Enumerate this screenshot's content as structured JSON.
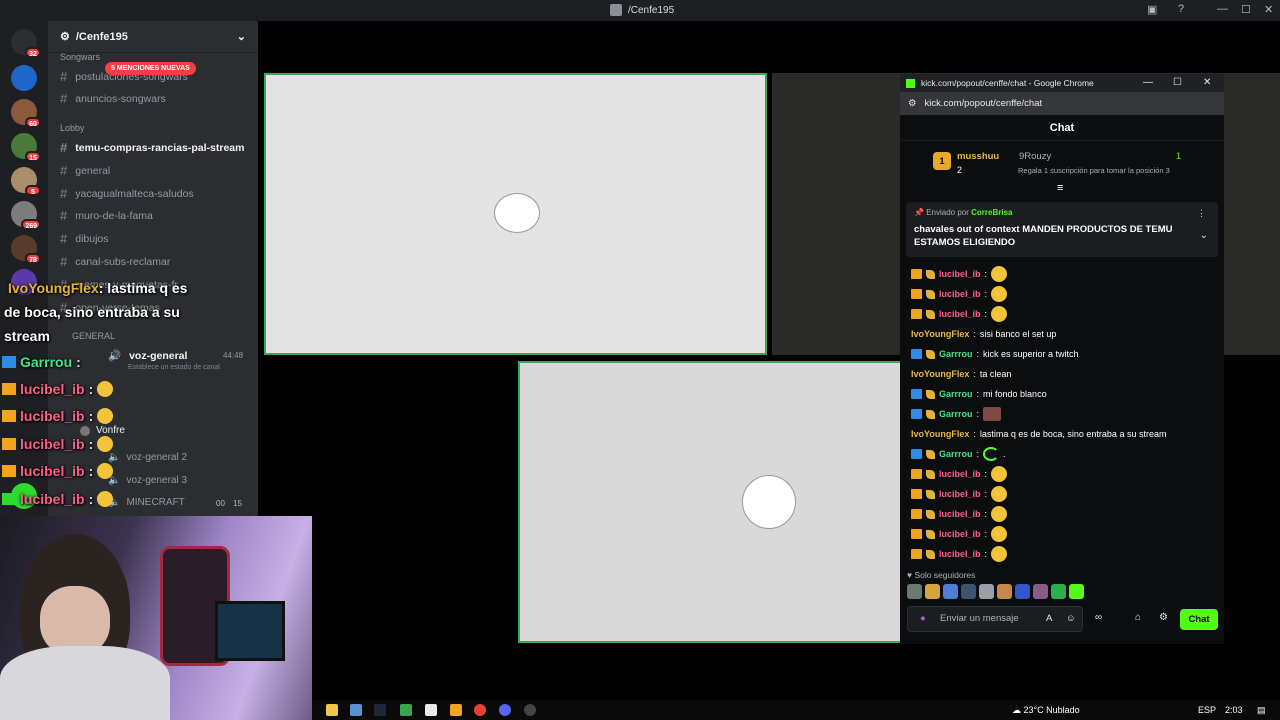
{
  "window": {
    "title": "/Cenfe195",
    "minimize": "—",
    "maximize": "☐",
    "close": "✕"
  },
  "discord": {
    "server_name": "/Cenfe195",
    "server_badges": [
      "32",
      "60",
      "15",
      "5",
      "269",
      "78"
    ],
    "mention_pill": "5 MENCIONES NUEVAS",
    "categories": {
      "songwars": "Songwars",
      "lobby": "Lobby",
      "general": "GENERAL"
    },
    "channels": [
      "postulaciones-songwars",
      "anuncios-songwars",
      "temu-compras-rancias-pal-stream",
      "general",
      "yacagualmalteca-saludos",
      "muro-de-la-fama",
      "dibujos",
      "canal-subs-reclamar",
      "memes-y-maquetas-fr",
      "open-verse-temas"
    ],
    "voice_channel": "voz-general",
    "voice_time": "44:48",
    "voice_status": "Establece un estado de canal",
    "voice_user": "Vonfre",
    "voice_channels": [
      "voz-general 2",
      "voz-general 3",
      "MINECRAFT"
    ],
    "minecraft_counts": [
      "00",
      "15"
    ]
  },
  "overlay": {
    "msg_user": "IvoYoungFlex",
    "msg_text_1": ": lastima q es",
    "msg_text_2": "de boca, sino entraba a su",
    "msg_text_3": "stream",
    "chat_lines": [
      {
        "user": "Garrrou",
        "sep": ":"
      },
      {
        "user": "lucibel_ib",
        "sep": ":"
      },
      {
        "user": "lucibel_ib",
        "sep": ":"
      },
      {
        "user": "lucibel_ib",
        "sep": ":"
      },
      {
        "user": "lucibel_ib",
        "sep": ":"
      },
      {
        "user": "lucibel_ib",
        "sep": ":"
      }
    ]
  },
  "kick": {
    "window_title": "kick.com/popout/cenffe/chat - Google Chrome",
    "url": "kick.com/popout/cenffe/chat",
    "chat_header": "Chat",
    "top_user": "musshuu",
    "top_user_count": "2",
    "top_right_count": "1",
    "gift_user": "9Rouzy",
    "gift_text": "Regala 1 suscripción para tomar la posición 3",
    "pinned_by_label": "Enviado por",
    "pinned_by_user": "CorreBrisa",
    "pinned_text": "chavales out of context MANDEN PRODUCTOS DE TEMU ESTAMOS ELIGIENDO",
    "messages": [
      {
        "user": "lucibel_ib",
        "color": "#ff5d8a",
        "text": "",
        "badges": [
          "b1",
          "b3"
        ],
        "emote": "em"
      },
      {
        "user": "lucibel_ib",
        "color": "#ff5d8a",
        "text": "",
        "badges": [
          "b1",
          "b3"
        ],
        "emote": "em"
      },
      {
        "user": "lucibel_ib",
        "color": "#ff5d8a",
        "text": "",
        "badges": [
          "b1",
          "b3"
        ],
        "emote": "em"
      },
      {
        "user": "IvoYoungFlex",
        "color": "#e8b64a",
        "text": "sisi banco el set up",
        "badges": [],
        "emote": ""
      },
      {
        "user": "Garrrou",
        "color": "#3fe88b",
        "text": "kick es superior a twitch",
        "badges": [
          "b2",
          "b3"
        ],
        "emote": ""
      },
      {
        "user": "IvoYoungFlex",
        "color": "#e8b64a",
        "text": "ta clean",
        "badges": [],
        "emote": ""
      },
      {
        "user": "Garrrou",
        "color": "#3fe88b",
        "text": "mi fondo blanco",
        "badges": [
          "b2",
          "b3"
        ],
        "emote": ""
      },
      {
        "user": "Garrrou",
        "color": "#3fe88b",
        "text": "",
        "badges": [
          "b2",
          "b3"
        ],
        "emote": "em2"
      },
      {
        "user": "IvoYoungFlex",
        "color": "#e8b64a",
        "text": "lastima q es de boca, sino entraba a su stream",
        "badges": [],
        "emote": ""
      },
      {
        "user": "Garrrou",
        "color": "#3fe88b",
        "text": ".",
        "badges": [
          "b2",
          "b3"
        ],
        "emote": "em3"
      },
      {
        "user": "lucibel_ib",
        "color": "#ff5d8a",
        "text": "",
        "badges": [
          "b1",
          "b3"
        ],
        "emote": "em"
      },
      {
        "user": "lucibel_ib",
        "color": "#ff5d8a",
        "text": "",
        "badges": [
          "b1",
          "b3"
        ],
        "emote": "em"
      },
      {
        "user": "lucibel_ib",
        "color": "#ff5d8a",
        "text": "",
        "badges": [
          "b1",
          "b3"
        ],
        "emote": "em"
      },
      {
        "user": "lucibel_ib",
        "color": "#ff5d8a",
        "text": "",
        "badges": [
          "b1",
          "b3"
        ],
        "emote": "em"
      },
      {
        "user": "lucibel_ib",
        "color": "#ff5d8a",
        "text": "",
        "badges": [
          "b1",
          "b3"
        ],
        "emote": "em"
      }
    ],
    "followers_only": "Solo seguidores",
    "input_placeholder": "Enviar un mensaje",
    "send_label": "Chat"
  },
  "taskbar": {
    "weather": "23°C Nublado",
    "lang": "ESP",
    "time": "2:03"
  },
  "colors": {
    "accent": "#53fc18",
    "discord_bg": "#2b2d31",
    "speaking": "#3ba55c"
  }
}
